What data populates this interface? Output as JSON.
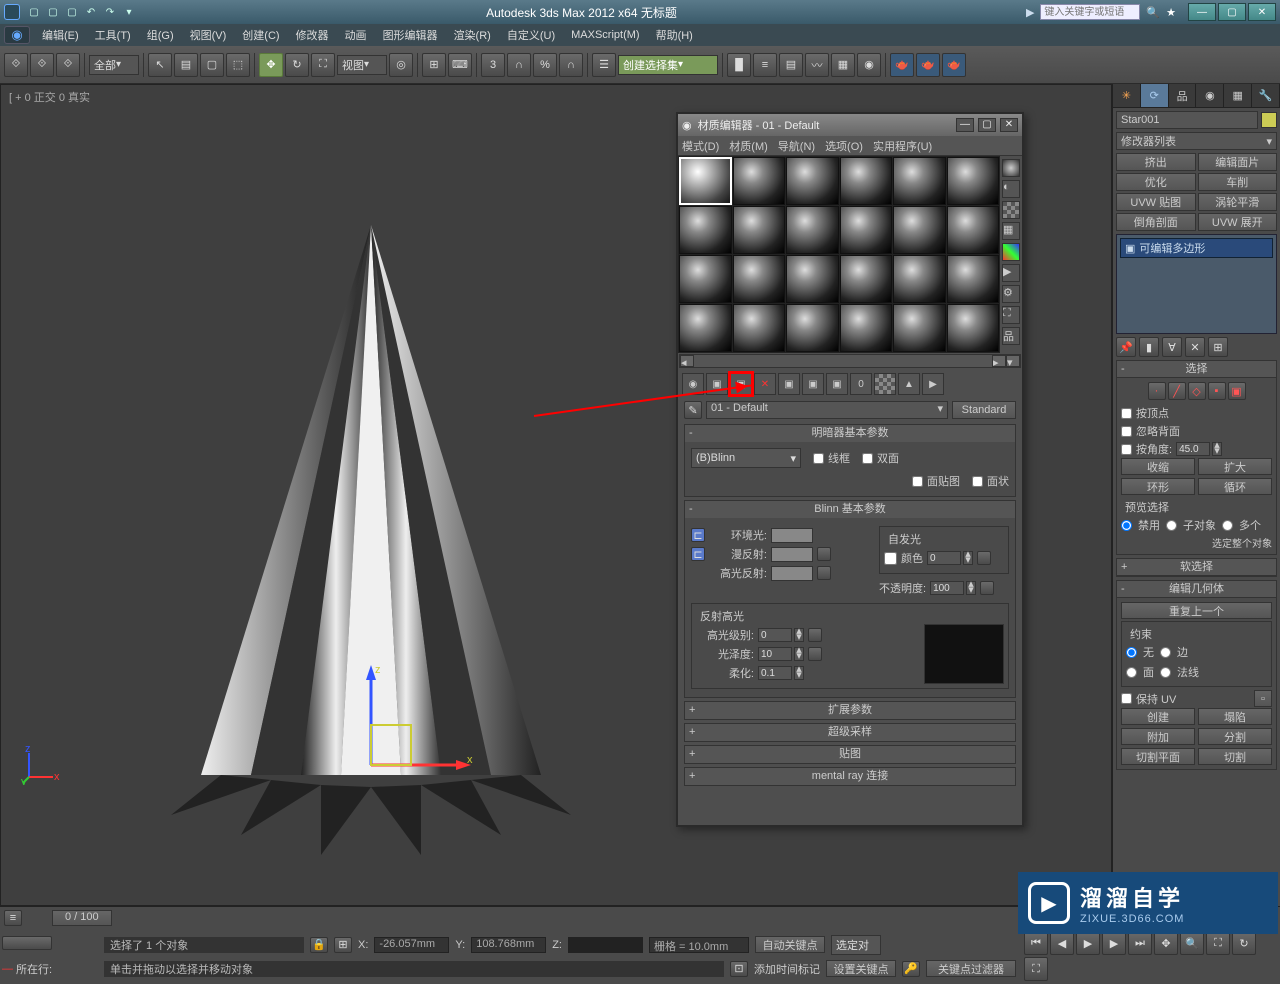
{
  "app": {
    "title": "Autodesk 3ds Max  2012 x64     无标题",
    "search_placeholder": "键入关键字或短语"
  },
  "menubar": [
    "编辑(E)",
    "工具(T)",
    "组(G)",
    "视图(V)",
    "创建(C)",
    "修改器",
    "动画",
    "图形编辑器",
    "渲染(R)",
    "自定义(U)",
    "MAXScript(M)",
    "帮助(H)"
  ],
  "toolbar": {
    "selmode": "全部",
    "refcoord": "视图",
    "selset": "创建选择集"
  },
  "viewport": {
    "label": "[ + 0 正交 0 真实"
  },
  "cmdpanel": {
    "objname": "Star001",
    "modlist": "修改器列表",
    "buttons": [
      "挤出",
      "编辑面片",
      "优化",
      "车削",
      "UVW 贴图",
      "涡轮平滑",
      "倒角剖面",
      "UVW 展开"
    ],
    "stack_item": "可编辑多边形",
    "selection": {
      "title": "选择",
      "byvertex": "按顶点",
      "ignorebackface": "忽略背面",
      "byangle": "按角度:",
      "angle": "45.0",
      "shrink": "收缩",
      "grow": "扩大",
      "ring": "环形",
      "loop": "循环",
      "preview": "预览选择",
      "disable": "禁用",
      "subobj": "子对象",
      "multi": "多个",
      "selwhole": "选定整个对象"
    },
    "softsel": "软选择",
    "editgeo": "编辑几何体",
    "repeat": "重复上一个",
    "constraint": {
      "title": "约束",
      "none": "无",
      "edge": "边",
      "face": "面",
      "normal": "法线"
    },
    "keepuv": "保持 UV",
    "create": "创建",
    "collapse": "塌陷",
    "attach": "附加",
    "detach": "分割",
    "sliceplane": "切割平面",
    "slice": "切割"
  },
  "timeslider": {
    "pos": "0 / 100"
  },
  "status": {
    "sel": "选择了 1 个对象",
    "hint": "单击并拖动以选择并移动对象",
    "x": "-26.057mm",
    "y": "108.768mm",
    "z": "",
    "grid": "栅格 = 10.0mm",
    "autokey": "自动关键点",
    "selset": "选定对",
    "setkey": "设置关键点",
    "keyfilter": "关键点过滤器",
    "now": "所在行:",
    "addtime": "添加时间标记"
  },
  "material": {
    "title": "材质编辑器 - 01 - Default",
    "menu": [
      "模式(D)",
      "材质(M)",
      "导航(N)",
      "选项(O)",
      "实用程序(U)"
    ],
    "name": "01 - Default",
    "type": "Standard",
    "roll_shader": "明暗器基本参数",
    "shader": "(B)Blinn",
    "wire": "线框",
    "twoside": "双面",
    "facemap": "面贴图",
    "faceted": "面状",
    "roll_blinn": "Blinn 基本参数",
    "selfillum": "自发光",
    "color": "颜色",
    "ambient": "环境光:",
    "diffuse": "漫反射:",
    "spec": "高光反射:",
    "opacity": "不透明度:",
    "opval": "100",
    "sival": "0",
    "spechi": "反射高光",
    "speclevel": "高光级别:",
    "slval": "0",
    "gloss": "光泽度:",
    "glval": "10",
    "soften": "柔化:",
    "sfval": "0.1",
    "roll_ext": "扩展参数",
    "roll_ss": "超级采样",
    "roll_maps": "贴图",
    "roll_mr": "mental ray 连接"
  },
  "watermark": {
    "brand": "溜溜自学",
    "url": "ZIXUE.3D66.COM"
  }
}
